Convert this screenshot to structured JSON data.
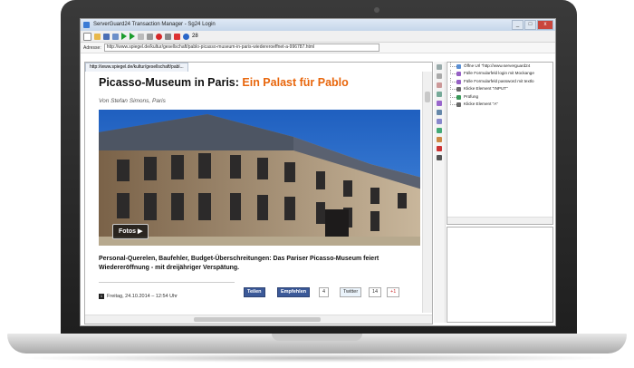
{
  "window": {
    "title": "ServerGuard24 Transaction Manager - Sg24 Login",
    "buttons": [
      "_",
      "□",
      "x"
    ]
  },
  "toolbar": {
    "zoom_label": "28"
  },
  "address": {
    "label": "Adresse:",
    "url": "http://www.spiegel.de/kultur/gesellschaft/pablo-picasso-museum-in-paris-wiedereroeffnet-a-996787.html"
  },
  "browser": {
    "tab_label": "http://www.spiegel.de/kultur/gesellschaft/pabl..."
  },
  "article": {
    "headline_main": "Picasso-Museum in Paris: ",
    "headline_accent": "Ein Palast für Pablo",
    "author": "Von Stefan Simons, Paris",
    "photo_button": "Fotos ▶",
    "teaser": "Personal-Querelen, Baufehler, Budget-Überschreitungen: Das Pariser Picasso-Museum feiert Wiedereröffnung - mit dreijähriger Verspätung.",
    "date": "Freitag, 24.10.2014 – 12:54 Uhr",
    "date_icon": "1"
  },
  "share": {
    "teilen": "Teilen",
    "empfehlen": "Empfehlen",
    "empfehlen_count": "4",
    "twitter": "Twitter",
    "twitter_count": "14",
    "gplus": "+1"
  },
  "steps": [
    "Öffne Url \"http://www.serverguard24",
    "Fülle Formularfeld login mit Mockange",
    "Fülle Formularfeld password mit textlo",
    "Klicke Element \"INPUT\"",
    "Prüfung",
    "Klicke Element \"A\""
  ],
  "colors": {
    "accent": "#e8660c",
    "facebook": "#3b5998",
    "titlebar": "#c5d6ea"
  }
}
